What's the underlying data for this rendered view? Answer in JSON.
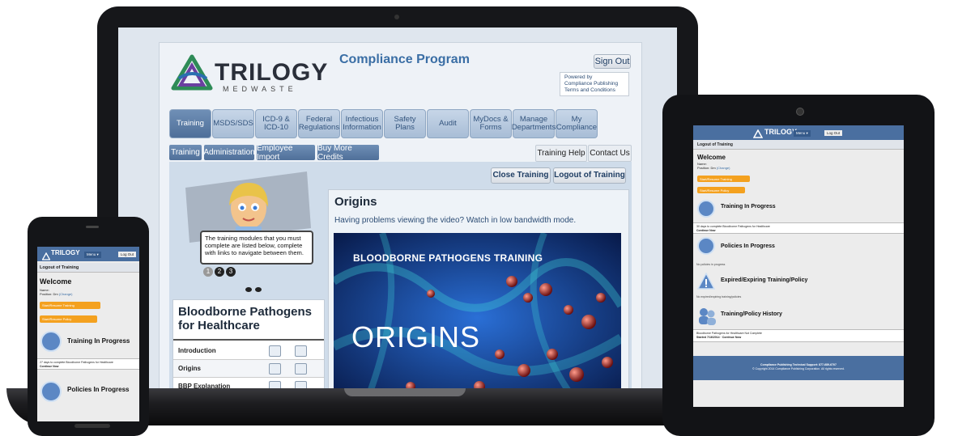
{
  "app": {
    "logo_main": "TRILOGY",
    "logo_sub": "MEDWASTE",
    "title": "Compliance Program",
    "sign_out": "Sign Out",
    "powered_by": [
      "Powered by",
      "Compliance Publishing",
      "Terms and Conditions"
    ]
  },
  "nav_tabs": [
    {
      "label": "Training"
    },
    {
      "label": "MSDS/SDS"
    },
    {
      "label": "ICD-9 & ICD-10"
    },
    {
      "label": "Federal Regulations"
    },
    {
      "label": "Infectious Information"
    },
    {
      "label": "Safety Plans"
    },
    {
      "label": "Audit"
    },
    {
      "label": "MyDocs & Forms"
    },
    {
      "label": "Manage Departments"
    },
    {
      "label": "My Compliance"
    }
  ],
  "sub_tabs": [
    {
      "label": "Training"
    },
    {
      "label": "Administration"
    },
    {
      "label": "Employee Import"
    },
    {
      "label": "Buy More Credits"
    }
  ],
  "right_tabs": {
    "help": "Training Help",
    "contact": "Contact Us"
  },
  "actions": {
    "close_training": "Close Training",
    "logout_training": "Logout of Training"
  },
  "assistant": {
    "message": "The training modules that you must complete are listed below, complete with links to navigate between them.",
    "steps": [
      "1",
      "2",
      "3"
    ]
  },
  "course": {
    "title": "Bloodborne Pathogens for Healthcare",
    "modules": [
      {
        "label": "Introduction"
      },
      {
        "label": "Origins"
      },
      {
        "label": "BBP Explanation"
      }
    ]
  },
  "lesson": {
    "title": "Origins",
    "help_text": "Having problems viewing the video? Watch in low bandwidth mode.",
    "video_banner": "BLOODBORNE PATHOGENS TRAINING",
    "video_title": "ORIGINS"
  },
  "tablet": {
    "logo": "TRILOGY",
    "menu": "Menu ▾",
    "logout": "Log Out",
    "breadcrumb": "Logout of Training",
    "welcome": "Welcome",
    "name_label": "Name:",
    "position_label": "Position: Dm",
    "change": "(Change)",
    "start_training": "Start/Resume Training",
    "start_policy": "Start/Resume Policy",
    "sections": [
      {
        "title": "Training In Progress",
        "note": "30 days to complete Bloodborne Pathogens for Healthcare",
        "link": "Continue Now"
      },
      {
        "title": "Policies In Progress",
        "note": "No policies in progress",
        "link": ""
      },
      {
        "title": "Expired/Expiring Training/Policy",
        "note": "No expired/expiring training/policies",
        "link": ""
      },
      {
        "title": "Training/Policy History",
        "note": "Bloodborne Pathogens for Healthcare Not Complete",
        "link": "Started 7/16/2014 · Continue Now"
      }
    ],
    "footer_line1": "Compliance Publishing Technical Support: 877-689-6707",
    "footer_line2": "© Copyright 2014 Compliance Publishing Corporation. All rights reserved."
  },
  "phone": {
    "logo": "TRILOGY",
    "menu": "Menu ▾",
    "logout": "Log Out",
    "breadcrumb": "Logout of Training",
    "welcome": "Welcome",
    "name_label": "Name:",
    "position_label": "Position: Dm",
    "change": "(Change)",
    "start_training": "Start/Resume Training",
    "start_policy": "Start/Resume Policy",
    "sections": [
      {
        "title": "Training In Progress",
        "note": "27 days to complete Bloodborne Pathogens for Healthcare",
        "link": "Continue Now"
      },
      {
        "title": "Policies In Progress"
      }
    ]
  },
  "colors": {
    "nav_blue": "#4f6f99",
    "orange": "#f4a11f",
    "title_blue": "#3a6ea5"
  }
}
